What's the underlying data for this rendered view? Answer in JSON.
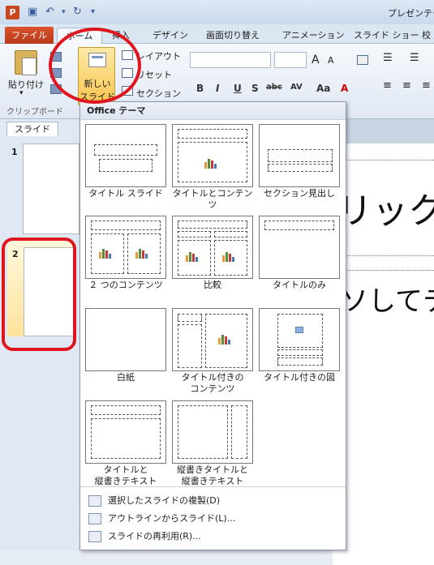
{
  "app": {
    "title": "プレゼンテー",
    "logo": "P"
  },
  "tabs": {
    "file": "ファイル",
    "home": "ホーム",
    "insert": "挿入",
    "design": "デザイン",
    "transitions": "画面切り替え",
    "animations": "アニメーション",
    "slideshow": "スライド ショー",
    "review": "校"
  },
  "ribbon": {
    "paste": "貼り付け",
    "clipboard_group": "クリップボード",
    "new_slide_line1": "新しい",
    "new_slide_line2": "スライド",
    "layout": "レイアウト",
    "reset": "リセット",
    "section": "セクション",
    "bold": "B",
    "italic": "I",
    "underline": "U",
    "strike": "S",
    "shadow": "abc",
    "spacing": "AV",
    "case": "Aa",
    "grow": "A",
    "shrink": "A"
  },
  "left_panel": {
    "slides_tab": "スライド",
    "slide1_num": "1",
    "slide2_num": "2"
  },
  "slide": {
    "title": "リック",
    "body": "ソしてテ"
  },
  "menu": {
    "header": "Office テーマ",
    "layouts": [
      {
        "label": "タイトル スライド"
      },
      {
        "label": "タイトルとコンテンツ"
      },
      {
        "label": "セクション見出し"
      },
      {
        "label": "２ つのコンテンツ"
      },
      {
        "label": "比較"
      },
      {
        "label": "タイトルのみ"
      },
      {
        "label": "白紙"
      },
      {
        "label1": "タイトル付きの",
        "label2": "コンテンツ"
      },
      {
        "label": "タイトル付きの図"
      },
      {
        "label1": "タイトルと",
        "label2": "縦書きテキスト"
      },
      {
        "label1": "縦書きタイトルと",
        "label2": "縦書きテキスト"
      }
    ],
    "items": [
      {
        "label": "選択したスライドの複製(D)"
      },
      {
        "label": "アウトラインからスライド(L)..."
      },
      {
        "label": "スライドの再利用(R)..."
      }
    ]
  },
  "colors": {
    "annotation": "#e0161e",
    "file_tab": "#c8471f",
    "new_slide_highlight": "#f9c54e"
  }
}
